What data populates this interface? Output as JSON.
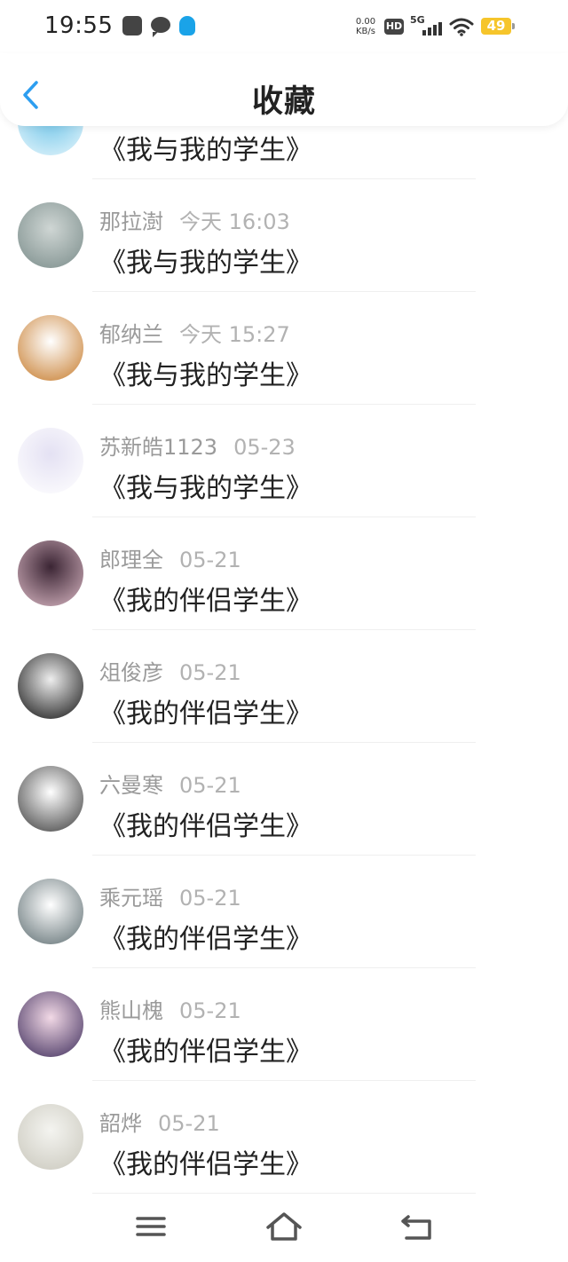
{
  "status_bar": {
    "time": "19:55",
    "net_speed_value": "0.00",
    "net_speed_unit": "KB/s",
    "hd_label": "HD",
    "network": "5G",
    "battery": "49"
  },
  "header": {
    "title": "收藏"
  },
  "favorites": [
    {
      "user": "",
      "date": "",
      "title": "《我与我的学生》",
      "avatar_colors": [
        "#6ec4e8",
        "#e7f6fc"
      ]
    },
    {
      "user": "那拉澍",
      "date": "今天 16:03",
      "title": "《我与我的学生》",
      "avatar_colors": [
        "#cfd6d4",
        "#7a8c8a"
      ]
    },
    {
      "user": "郁纳兰",
      "date": "今天 15:27",
      "title": "《我与我的学生》",
      "avatar_colors": [
        "#ffffff",
        "#c67a2a"
      ]
    },
    {
      "user": "苏新皓1123",
      "date": "05-23",
      "title": "《我与我的学生》",
      "avatar_colors": [
        "#e4e1f3",
        "#ffffff"
      ]
    },
    {
      "user": "郎理全",
      "date": "05-21",
      "title": "《我的伴侣学生》",
      "avatar_colors": [
        "#3b2534",
        "#d9b7c3"
      ]
    },
    {
      "user": "俎俊彦",
      "date": "05-21",
      "title": "《我的伴侣学生》",
      "avatar_colors": [
        "#eeeeee",
        "#111111"
      ]
    },
    {
      "user": "六曼寒",
      "date": "05-21",
      "title": "《我的伴侣学生》",
      "avatar_colors": [
        "#ffffff",
        "#3b3b3b"
      ]
    },
    {
      "user": "乘元瑶",
      "date": "05-21",
      "title": "《我的伴侣学生》",
      "avatar_colors": [
        "#ffffff",
        "#5c6c70"
      ]
    },
    {
      "user": "熊山槐",
      "date": "05-21",
      "title": "《我的伴侣学生》",
      "avatar_colors": [
        "#f2d9e6",
        "#3c2b5a"
      ]
    },
    {
      "user": "韶烨",
      "date": "05-21",
      "title": "《我的伴侣学生》",
      "avatar_colors": [
        "#f4f4f0",
        "#c9c7bc"
      ]
    }
  ],
  "nav": {
    "menu_icon": "menu-icon",
    "home_icon": "home-icon",
    "back_icon": "back-icon"
  },
  "colors": {
    "accent_blue": "#2d9ef0",
    "text_primary": "#222222",
    "text_secondary": "#9a9a9a"
  }
}
